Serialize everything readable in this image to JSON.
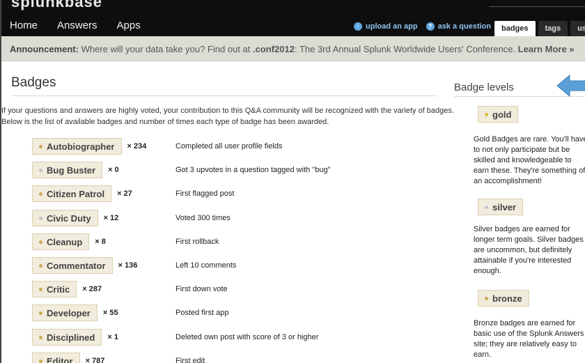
{
  "logo": "splunkbase",
  "nav": [
    "Home",
    "Answers",
    "Apps"
  ],
  "actions": [
    {
      "label": "upload an app",
      "icon": "upload-icon"
    },
    {
      "label": "ask a question",
      "icon": "question-icon"
    }
  ],
  "tabs": [
    "badges",
    "tags",
    "use"
  ],
  "announcement": {
    "label": "Announcement:",
    "text1": " Where will your data take you? Find out at ",
    "conf": ".conf2012",
    "text2": ": The 3rd Annual Splunk Worldwide Users' Conference. ",
    "more": "Learn More »"
  },
  "page_title": "Badges",
  "intro": "If your questions and answers are highly voted, your contribution to this Q&A community will be recognized with the variety of badges. Below is the list of available badges and number of times each type of badge has been awarded.",
  "badges": [
    {
      "name": "Autobiographer",
      "count": "× 234",
      "level": "bronze",
      "desc": "Completed all user profile fields"
    },
    {
      "name": "Bug Buster",
      "count": "× 0",
      "level": "silver",
      "desc": "Got 3 upvotes in a question tagged with \"bug\""
    },
    {
      "name": "Citizen Patrol",
      "count": "× 27",
      "level": "bronze",
      "desc": "First flagged post"
    },
    {
      "name": "Civic Duty",
      "count": "× 12",
      "level": "silver",
      "desc": "Voted 300 times"
    },
    {
      "name": "Cleanup",
      "count": "× 8",
      "level": "bronze",
      "desc": "First rollback"
    },
    {
      "name": "Commentator",
      "count": "× 136",
      "level": "bronze",
      "desc": "Left 10 comments"
    },
    {
      "name": "Critic",
      "count": "× 287",
      "level": "bronze",
      "desc": "First down vote"
    },
    {
      "name": "Developer",
      "count": "× 55",
      "level": "bronze",
      "desc": "Posted first app"
    },
    {
      "name": "Disciplined",
      "count": "× 1",
      "level": "bronze",
      "desc": "Deleted own post with score of 3 or higher"
    },
    {
      "name": "Editor",
      "count": "× 787",
      "level": "bronze",
      "desc": "First edit"
    }
  ],
  "sidebar": {
    "title": "Badge levels",
    "levels": [
      {
        "name": "gold",
        "dot": "gold",
        "text": "Gold Badges are rare. You'll have to not only participate but be skilled and knowledgeable to earn these. They're something of an accomplishment!"
      },
      {
        "name": "silver",
        "dot": "silver",
        "text": "Silver badges are earned for longer term goals. Silver badges are uncommon, but definitely attainable if you're interested enough."
      },
      {
        "name": "bronze",
        "dot": "bronze",
        "text": "Bronze badges are earned for basic use of the Splunk Answers site; they are relatively easy to earn."
      }
    ]
  },
  "colors": {
    "topbar": "#0e0e0e",
    "announce_bg": "#dcdcd4",
    "link": "#8fc3ef",
    "badge_bg": "#f1ecdc",
    "arrow": "#5b9fd8"
  }
}
